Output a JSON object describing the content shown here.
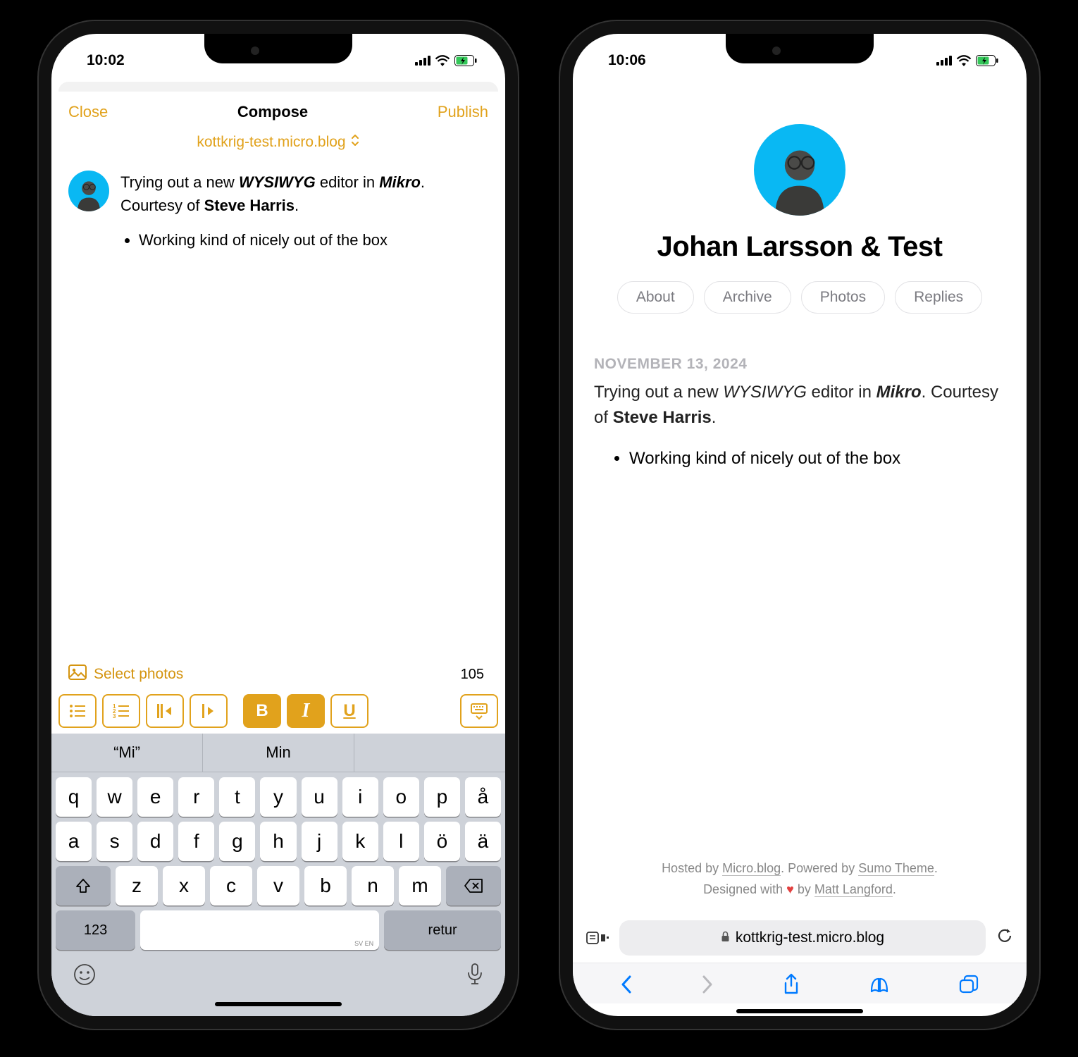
{
  "left": {
    "status": {
      "time": "10:02"
    },
    "header": {
      "close": "Close",
      "title": "Compose",
      "publish": "Publish"
    },
    "blog_picker": "kottkrig-test.micro.blog",
    "compose": {
      "line1_a": "Trying out a new ",
      "line1_b": "WYSIWYG",
      "line1_c": " editor in ",
      "line2_a": "Mikro",
      "line2_b": ". Courtesy of ",
      "line2_c": "Steve Harris",
      "line2_d": ".",
      "bullet1": "Working kind of nicely out of the box"
    },
    "photo_button": "Select photos",
    "char_count": "105",
    "toolbar": {
      "bold": "B",
      "italic": "I",
      "underline": "U"
    },
    "suggestions": [
      "“Mi”",
      "Min",
      ""
    ],
    "keyboard": {
      "row1": [
        "q",
        "w",
        "e",
        "r",
        "t",
        "y",
        "u",
        "i",
        "o",
        "p",
        "å"
      ],
      "row2": [
        "a",
        "s",
        "d",
        "f",
        "g",
        "h",
        "j",
        "k",
        "l",
        "ö",
        "ä"
      ],
      "row3": [
        "z",
        "x",
        "c",
        "v",
        "b",
        "n",
        "m"
      ],
      "number_key": "123",
      "return_key": "retur",
      "locale": "SV EN"
    }
  },
  "right": {
    "status": {
      "time": "10:06"
    },
    "profile_name": "Johan Larsson & Test",
    "nav": [
      "About",
      "Archive",
      "Photos",
      "Replies"
    ],
    "post": {
      "date": "NOVEMBER 13, 2024",
      "body_a": "Trying out a new ",
      "body_b": "WYSIWYG",
      "body_c": " editor in ",
      "body_d": "Mikro",
      "body_e": ". Courtesy of ",
      "body_f": "Steve Harris",
      "body_g": ".",
      "bullet1": "Working kind of nicely out of the box"
    },
    "footer": {
      "l1a": "Hosted by ",
      "l1b": "Micro.blog",
      "l1c": ". Powered by ",
      "l1d": "Sumo Theme",
      "l1e": ".",
      "l2a": "Designed with ",
      "l2b": " by ",
      "l2c": "Matt Langford",
      "l2d": "."
    },
    "url": "kottkrig-test.micro.blog"
  }
}
